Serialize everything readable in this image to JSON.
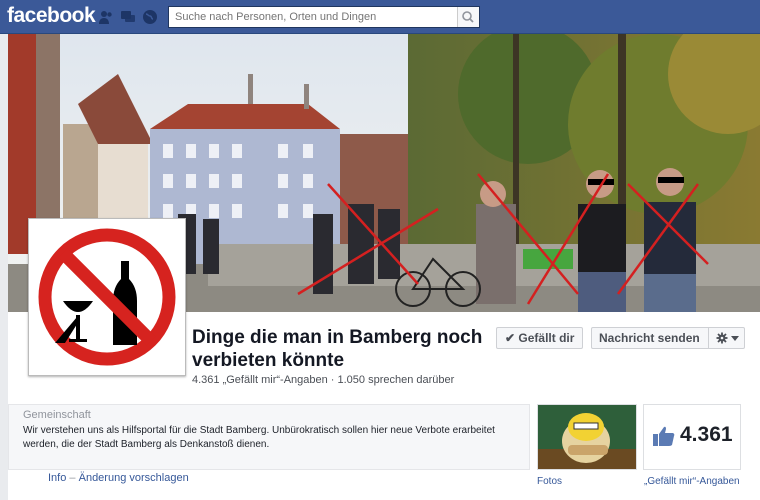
{
  "topbar": {
    "logo": "facebook",
    "search_placeholder": "Suche nach Personen, Orten und Dingen"
  },
  "page": {
    "title": "Dinge die man in Bamberg noch verbieten könnte",
    "stats": "4.361 „Gefällt mir“-Angaben · 1.050 sprechen darüber",
    "buttons": {
      "liked": "Gefällt dir",
      "message": "Nachricht senden"
    }
  },
  "about": {
    "category": "Gemeinschaft",
    "description": "Wir verstehen uns als Hilfsportal für die Stadt Bamberg. Unbürokratisch sollen hier neue Verbote erarbeitet werden, die der Stadt Bamberg als Denkanstoß dienen.",
    "links": {
      "info": "Info",
      "separator": "–",
      "suggest": "Änderung vorschlagen"
    }
  },
  "tiles": {
    "photos_label": "Fotos",
    "likes_count": "4.361",
    "likes_label": "„Gefällt mir“-Angaben"
  }
}
